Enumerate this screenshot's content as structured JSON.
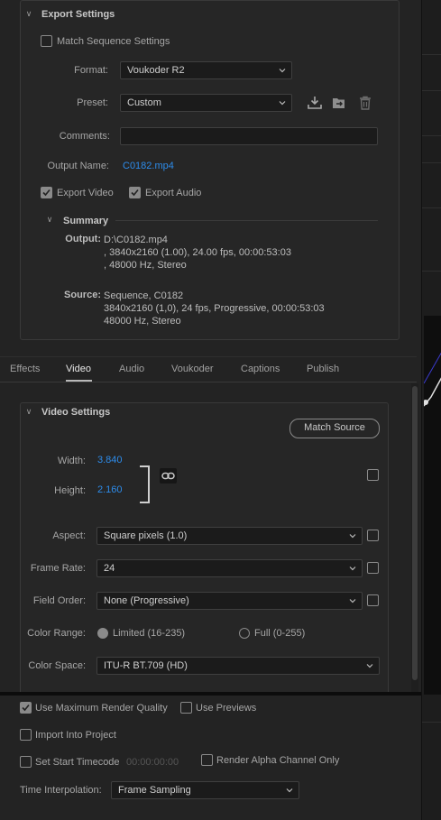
{
  "export_settings": {
    "title": "Export Settings",
    "match_sequence": {
      "label": "Match Sequence Settings",
      "checked": false
    },
    "format": {
      "label": "Format:",
      "value": "Voukoder R2"
    },
    "preset": {
      "label": "Preset:",
      "value": "Custom"
    },
    "preset_icons": [
      "save-preset-icon",
      "import-preset-icon",
      "delete-preset-icon"
    ],
    "comments": {
      "label": "Comments:",
      "value": ""
    },
    "output_name": {
      "label": "Output Name:",
      "value": "C0182.mp4"
    },
    "export_video": {
      "label": "Export Video",
      "checked": true
    },
    "export_audio": {
      "label": "Export Audio",
      "checked": true
    }
  },
  "summary": {
    "title": "Summary",
    "output_key": "Output:",
    "output_lines": [
      "D:\\C0182.mp4",
      ", 3840x2160 (1.00), 24.00 fps, 00:00:53:03",
      ", 48000 Hz, Stereo"
    ],
    "source_key": "Source:",
    "source_lines": [
      "Sequence, C0182",
      "3840x2160 (1,0), 24 fps, Progressive, 00:00:53:03",
      "48000 Hz, Stereo"
    ]
  },
  "tabs": [
    {
      "label": "Effects",
      "active": false
    },
    {
      "label": "Video",
      "active": true
    },
    {
      "label": "Audio",
      "active": false
    },
    {
      "label": "Voukoder",
      "active": false
    },
    {
      "label": "Captions",
      "active": false
    },
    {
      "label": "Publish",
      "active": false
    }
  ],
  "video_settings": {
    "title": "Video Settings",
    "match_source": "Match Source",
    "width": {
      "label": "Width:",
      "value": "3.840"
    },
    "height": {
      "label": "Height:",
      "value": "2.160"
    },
    "aspect": {
      "label": "Aspect:",
      "value": "Square pixels (1.0)"
    },
    "frame_rate": {
      "label": "Frame Rate:",
      "value": "24"
    },
    "field_order": {
      "label": "Field Order:",
      "value": "None (Progressive)"
    },
    "color_range": {
      "label": "Color Range:",
      "options": [
        "Limited (16-235)",
        "Full (0-255)"
      ],
      "selected": "Limited (16-235)"
    },
    "color_space": {
      "label": "Color Space:",
      "value": "ITU-R BT.709 (HD)"
    }
  },
  "bottom": {
    "max_render_quality": {
      "label": "Use Maximum Render Quality",
      "checked": true
    },
    "use_previews": {
      "label": "Use Previews",
      "checked": false
    },
    "import_into_project": {
      "label": "Import Into Project",
      "checked": false
    },
    "set_start_timecode": {
      "label": "Set Start Timecode",
      "checked": false,
      "timecode": "00:00:00:00"
    },
    "render_alpha": {
      "label": "Render Alpha Channel Only",
      "checked": false
    },
    "time_interpolation": {
      "label": "Time Interpolation:",
      "value": "Frame Sampling"
    }
  },
  "colors": {
    "accent": "#2d8ceb",
    "background": "#232323",
    "panel": "#262626"
  }
}
